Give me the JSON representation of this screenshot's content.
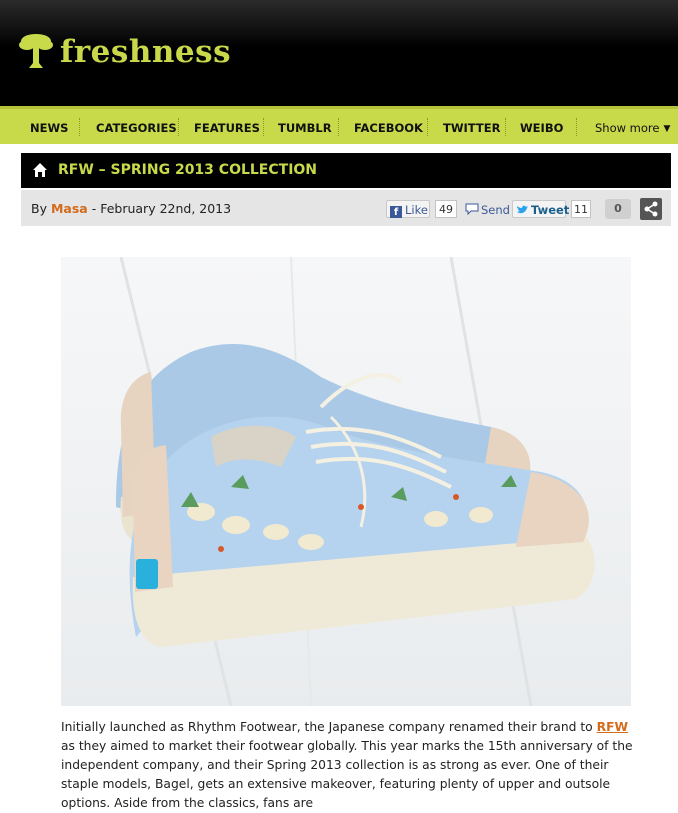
{
  "site": {
    "name": "freshness",
    "brand_color": "#c8d94a",
    "header_bg": "#000000",
    "accent_link": "#d36b1a"
  },
  "nav": {
    "items": [
      "NEWS",
      "CATEGORIES",
      "FEATURES",
      "TUMBLR",
      "FACEBOOK",
      "TWITTER",
      "WEIBO"
    ],
    "more_label": "Show more"
  },
  "post": {
    "title": "RFW – SPRING 2013 COLLECTION",
    "byline_prefix": "By",
    "author": "Masa",
    "date_sep": "-",
    "date": "February 22nd, 2013"
  },
  "social": {
    "like_label": "Like",
    "like_count": "49",
    "send_label": "Send",
    "tweet_label": "Tweet",
    "tweet_count": "11",
    "comment_count": "0"
  },
  "hero": {
    "icon": "sneaker-photo",
    "alt": "RFW Bagel sneakers with bird print"
  },
  "article": {
    "text_before": "Initially launched as Rhythm Footwear, the Japanese company renamed their brand to ",
    "link": "RFW",
    "text_after": " as they aimed to market their footwear globally. This year marks the 15th anniversary of the independent company, and their Spring 2013 collection is as strong as ever. One of their staple models, Bagel, gets an extensive makeover, featuring plenty of upper and outsole options. Aside from the classics, fans are"
  }
}
